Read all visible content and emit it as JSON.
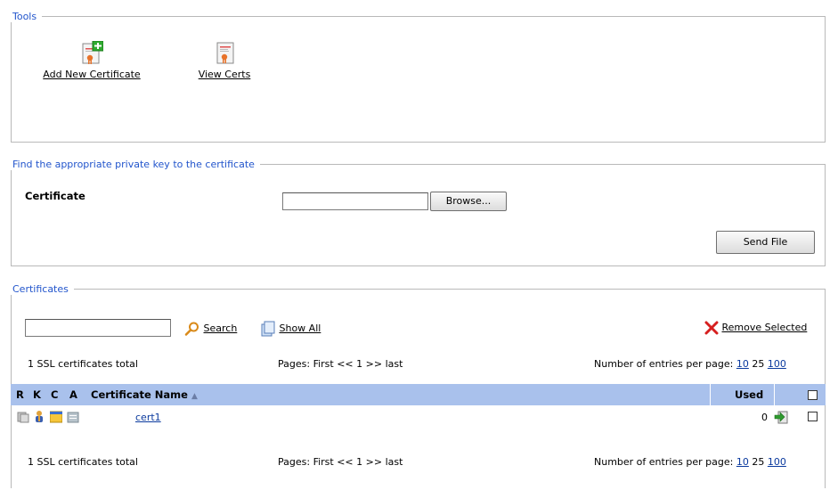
{
  "tools": {
    "legend": "Tools",
    "add_label": "Add New Certificate",
    "view_label": "View Certs"
  },
  "find": {
    "legend": "Find the appropriate private key to the certificate",
    "certificate_label": "Certificate",
    "file_value": "",
    "browse_label": "Browse...",
    "send_label": "Send File"
  },
  "certs": {
    "legend": "Certificates",
    "search_value": "",
    "search_label": "Search",
    "show_all_label": "Show All",
    "remove_label": "Remove Selected",
    "total_text": "1 SSL certificates total",
    "pages_text": "Pages: First << 1 >> last",
    "entries_text": "Number of entries per page:",
    "entries_options": [
      "10",
      "25",
      "100"
    ],
    "columns": {
      "r": "R",
      "k": "K",
      "c": "C",
      "a": "A",
      "name": "Certificate Name",
      "sort_indicator": "▲",
      "used": "Used"
    },
    "rows": [
      {
        "name": "cert1",
        "used": "0"
      }
    ],
    "total_text_bottom": "1 SSL certificates total",
    "pages_text_bottom": "Pages: First << 1 >> last",
    "entries_text_bottom": "Number of entries per page:"
  },
  "colors": {
    "legend": "#2255cc",
    "header_bg": "#a9c1ec",
    "remove_x": "#d61f1f"
  }
}
